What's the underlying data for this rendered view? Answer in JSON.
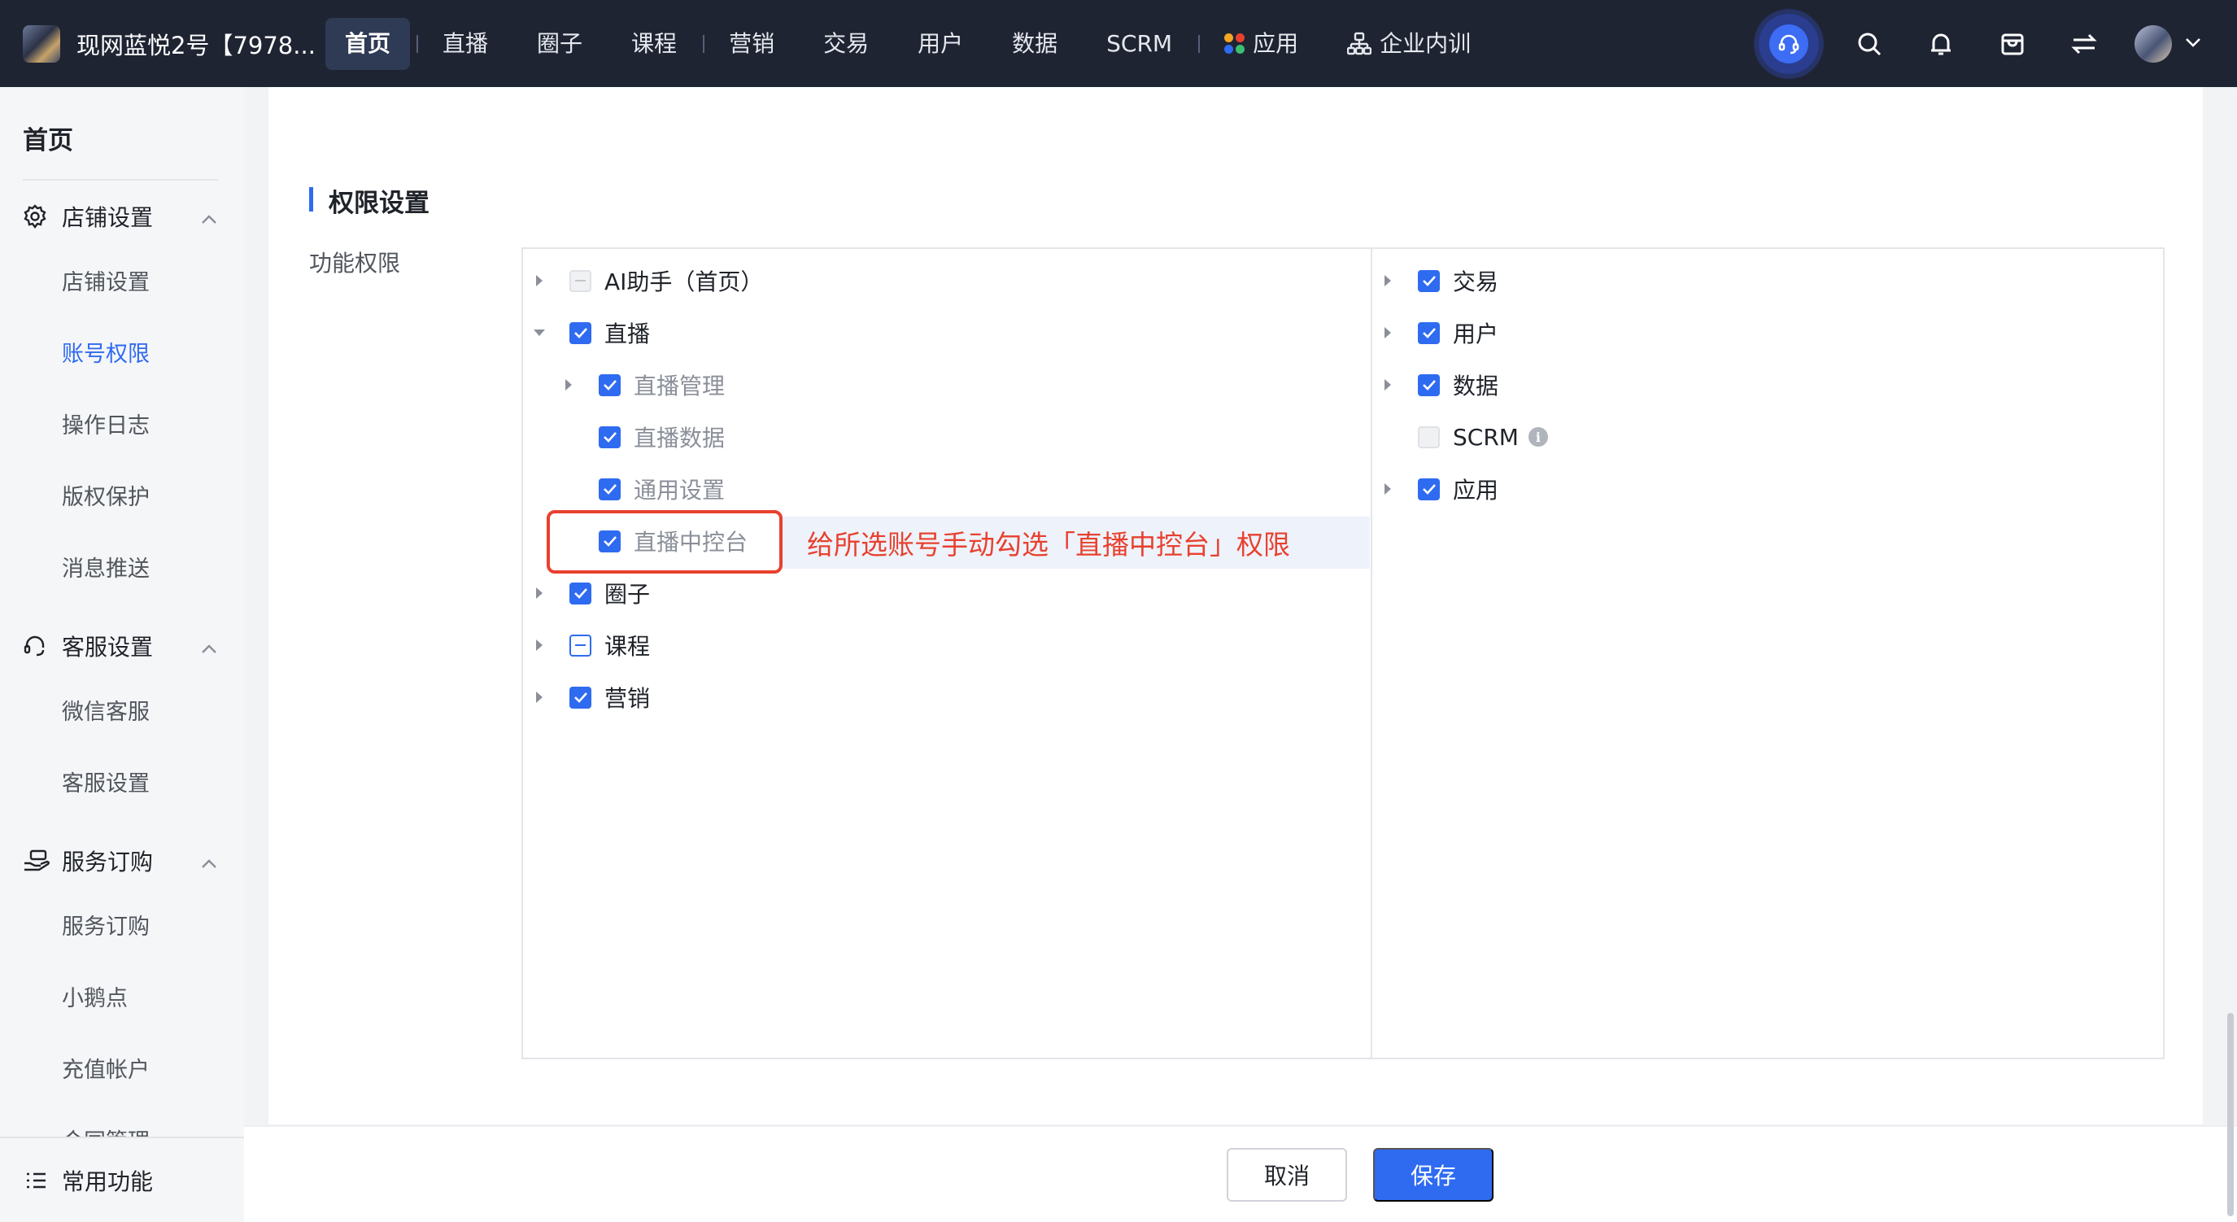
{
  "topbar": {
    "shop_name": "现网蓝悦2号【7978...",
    "nav": [
      "首页",
      "直播",
      "圈子",
      "课程",
      "营销",
      "交易",
      "用户",
      "数据",
      "SCRM",
      "应用",
      "企业内训"
    ]
  },
  "sidebar": {
    "title": "首页",
    "groups": [
      {
        "label": "店铺设置",
        "items": [
          "店铺设置",
          "账号权限",
          "操作日志",
          "版权保护",
          "消息推送"
        ]
      },
      {
        "label": "客服设置",
        "items": [
          "微信客服",
          "客服设置"
        ]
      },
      {
        "label": "服务订购",
        "items": [
          "服务订购",
          "小鹅点",
          "充值帐户",
          "合同管理"
        ]
      }
    ],
    "footer": "常用功能"
  },
  "main": {
    "section_title": "权限设置",
    "field_label": "功能权限",
    "left_tree": [
      {
        "label": "AI助手（首页）",
        "state": "disabled-partial",
        "expand": "collapsed"
      },
      {
        "label": "直播",
        "state": "checked",
        "expand": "expanded"
      },
      {
        "label": "直播管理",
        "state": "checked",
        "expand": "collapsed"
      },
      {
        "label": "直播数据",
        "state": "checked",
        "expand": "none"
      },
      {
        "label": "通用设置",
        "state": "checked",
        "expand": "none"
      },
      {
        "label": "直播中控台",
        "state": "checked",
        "expand": "none"
      },
      {
        "label": "圈子",
        "state": "checked",
        "expand": "collapsed"
      },
      {
        "label": "课程",
        "state": "partial",
        "expand": "collapsed"
      },
      {
        "label": "营销",
        "state": "checked",
        "expand": "collapsed"
      }
    ],
    "right_tree": [
      {
        "label": "交易",
        "state": "checked",
        "expand": "collapsed"
      },
      {
        "label": "用户",
        "state": "checked",
        "expand": "collapsed"
      },
      {
        "label": "数据",
        "state": "checked",
        "expand": "collapsed"
      },
      {
        "label": "SCRM",
        "state": "disabled",
        "expand": "none"
      },
      {
        "label": "应用",
        "state": "checked",
        "expand": "collapsed"
      }
    ],
    "annotation": "给所选账号手动勾选「直播中控台」权限"
  },
  "footer": {
    "cancel": "取消",
    "save": "保存"
  },
  "colors": {
    "accent": "#2f6bf0",
    "nav_bg": "#1f2433",
    "annotation": "#e8412f"
  },
  "icons": [
    "customer-service-icon",
    "search-icon",
    "bell-icon",
    "store-icon",
    "switch-icon",
    "chevron-down-icon",
    "gear-icon",
    "headset-icon",
    "hand-service-icon",
    "list-icon",
    "info-icon",
    "apps-icon",
    "org-chart-icon"
  ]
}
